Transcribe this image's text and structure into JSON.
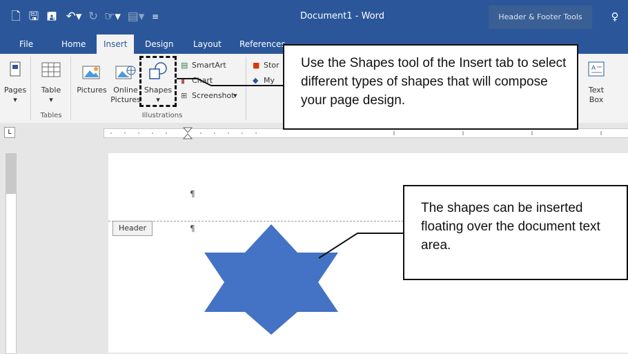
{
  "title_bar": {
    "document_title": "Document1  -  Word",
    "contextual_tab": "Header & Footer Tools"
  },
  "tabs": [
    "File",
    "Home",
    "Insert",
    "Design",
    "Layout",
    "References"
  ],
  "active_tab": "Insert",
  "ribbon": {
    "pages_label": "Pages",
    "table_label": "Table",
    "tables_group": "Tables",
    "pictures_label": "Pictures",
    "online_pictures_line1": "Online",
    "online_pictures_line2": "Pictures",
    "shapes_label": "Shapes",
    "smartart_label": "SmartArt",
    "chart_label": "Chart",
    "screenshot_label": "Screenshot",
    "illustrations_group": "Illustrations",
    "store_label_partial": "Stor",
    "my_addins_partial": "My",
    "text_box_line1": "Text",
    "text_box_line2": "Box"
  },
  "document": {
    "header_tag": "Header",
    "paragraph_mark": "¶"
  },
  "callouts": {
    "shapes_tool": "Use the Shapes tool of the Insert tab to select different types of shapes that will compose your page design.",
    "floating_shapes": "The shapes can be inserted floating over the document text area."
  },
  "colors": {
    "word_blue": "#2b579a",
    "shape_fill": "#4472c4"
  }
}
